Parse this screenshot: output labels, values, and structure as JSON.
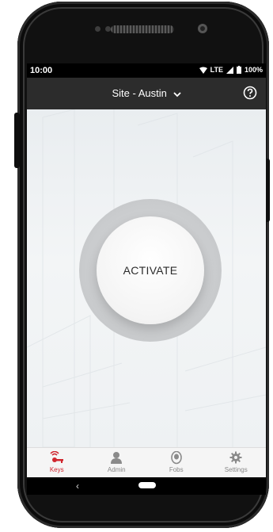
{
  "status_bar": {
    "time": "10:00",
    "network": "LTE",
    "battery": "100%"
  },
  "app_bar": {
    "site_label": "Site - Austin",
    "dropdown_icon": "chevron-down-icon",
    "help_icon": "help-circle-icon"
  },
  "main": {
    "activate_label": "ACTIVATE"
  },
  "tabs": [
    {
      "label": "Keys",
      "icon": "key-signal-icon",
      "active": true
    },
    {
      "label": "Admin",
      "icon": "user-icon",
      "active": false
    },
    {
      "label": "Fobs",
      "icon": "fob-icon",
      "active": false
    },
    {
      "label": "Settings",
      "icon": "gear-icon",
      "active": false
    }
  ],
  "colors": {
    "accent": "#d0262e",
    "app_bar": "#2c2c2c",
    "tab_inactive": "#888888"
  }
}
